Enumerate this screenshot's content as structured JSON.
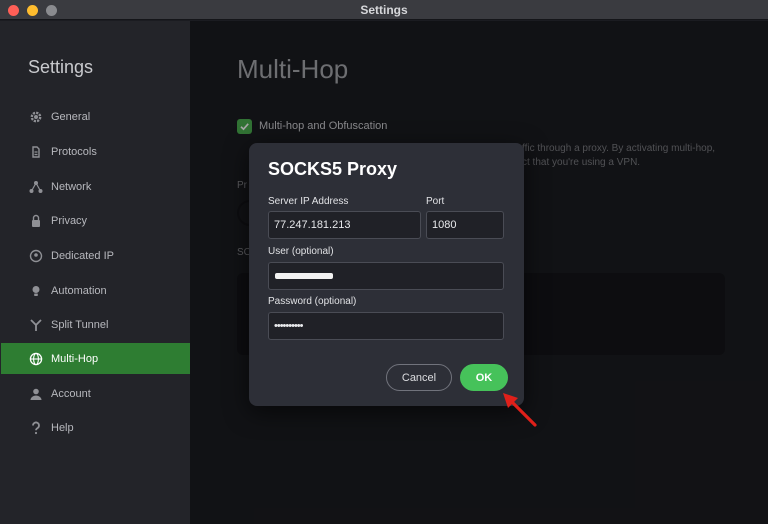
{
  "window": {
    "title": "Settings"
  },
  "sidebar": {
    "title": "Settings",
    "items": [
      {
        "label": "General",
        "icon": "gear-icon"
      },
      {
        "label": "Protocols",
        "icon": "protocols-icon"
      },
      {
        "label": "Network",
        "icon": "network-icon"
      },
      {
        "label": "Privacy",
        "icon": "shield-icon"
      },
      {
        "label": "Dedicated IP",
        "icon": "dedicated-ip-icon"
      },
      {
        "label": "Automation",
        "icon": "lightbulb-icon"
      },
      {
        "label": "Split Tunnel",
        "icon": "split-tunnel-icon"
      },
      {
        "label": "Multi-Hop",
        "icon": "globe-icon",
        "active": true
      },
      {
        "label": "Account",
        "icon": "user-icon"
      },
      {
        "label": "Help",
        "icon": "question-icon"
      }
    ]
  },
  "main": {
    "title": "Multi-Hop",
    "checkbox_label": "Multi-hop and Obfuscation",
    "checkbox_checked": true,
    "desc_line1": "ffic through a proxy. By activating multi-hop,",
    "desc_line2": "ct that you're using a VPN.",
    "fragment_pr": "Pr",
    "fragment_sc": "SC"
  },
  "dialog": {
    "title": "SOCKS5 Proxy",
    "server_ip_label": "Server IP Address",
    "server_ip_value": "77.247.181.213",
    "port_label": "Port",
    "port_value": "1080",
    "user_label": "User (optional)",
    "password_label": "Password (optional)",
    "password_value": "••••••••••",
    "cancel_label": "Cancel",
    "ok_label": "OK"
  },
  "colors": {
    "accent": "#46c25a",
    "sidebar_active": "#2e7d32",
    "annotation_arrow": "#e0201a"
  }
}
